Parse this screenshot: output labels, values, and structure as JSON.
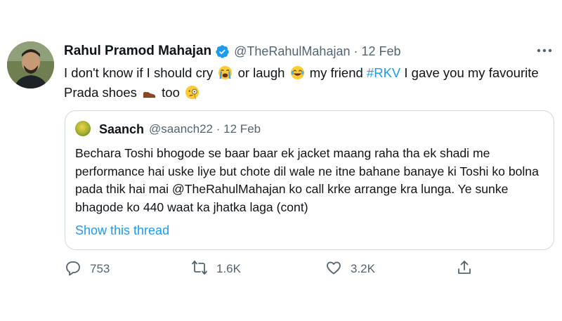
{
  "author": {
    "display_name": "Rahul Pramod Mahajan",
    "handle": "@TheRahulMahajan",
    "date": "12 Feb",
    "separator": "·",
    "verified": true
  },
  "tweet": {
    "text_1": "I don't know if I should cry",
    "emoji_1": "loudly-crying-face",
    "text_2": "or laugh",
    "emoji_2": "face-with-tears-of-joy",
    "text_3": "my friend",
    "hashtag": "#RKV",
    "text_4": "I gave you my favourite Prada shoes",
    "emoji_3": "mans-shoe",
    "text_5": "too",
    "emoji_4": "face-with-monocle"
  },
  "quoted_tweet": {
    "display_name": "Saanch",
    "handle": "@saanch22",
    "separator": "·",
    "date": "12 Feb",
    "text": "Bechara Toshi bhogode se baar baar ek jacket maang raha tha ek shadi me performance hai uske liye but chote dil wale ne itne bahane banaye ki Toshi ko bolna pada thik hai mai @TheRahulMahajan ko call krke arrange kra lunga. Ye sunke bhagode ko 440 waat ka jhatka laga (cont)",
    "show_thread": "Show this thread"
  },
  "actions": {
    "reply_count": "753",
    "retweet_count": "1.6K",
    "like_count": "3.2K"
  },
  "colors": {
    "link": "#1d9bf0",
    "secondary_text": "#536471",
    "primary_text": "#0f1419",
    "border": "#cfd9de"
  },
  "icons": [
    "verified-badge-icon",
    "more-icon",
    "reply-icon",
    "retweet-icon",
    "like-icon",
    "share-icon"
  ]
}
